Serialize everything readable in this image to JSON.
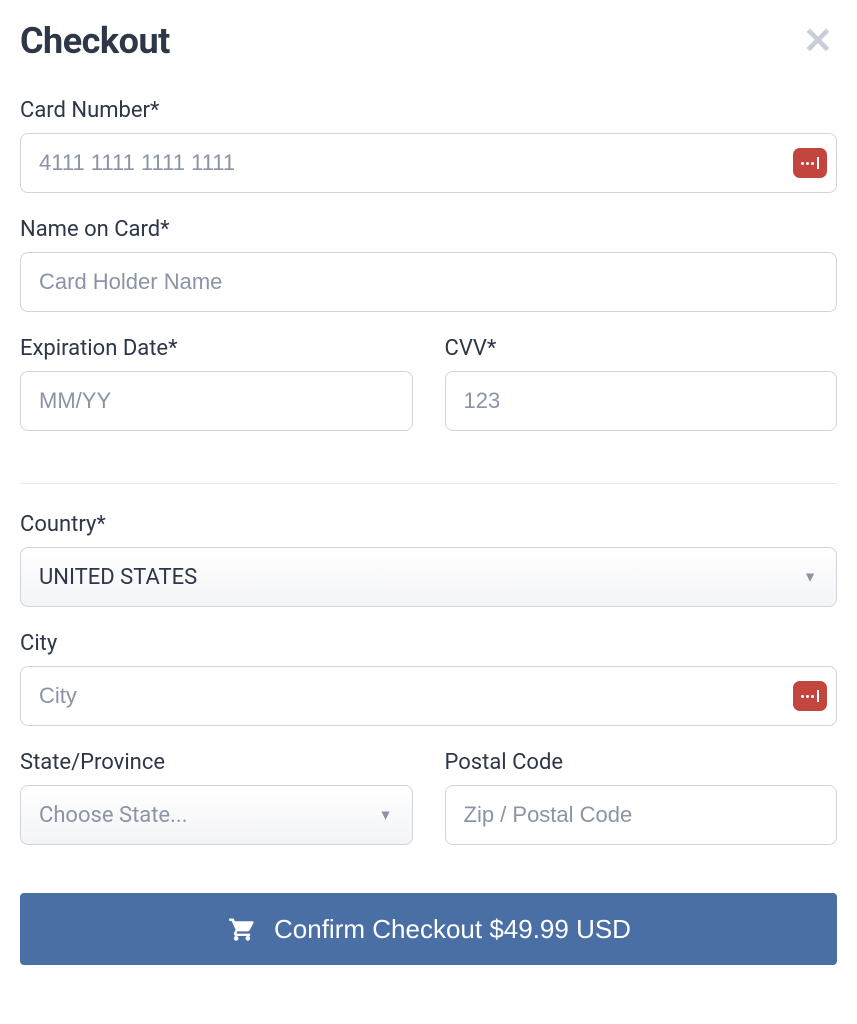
{
  "header": {
    "title": "Checkout"
  },
  "card_number": {
    "label": "Card Number*",
    "placeholder": "4111 1111 1111 1111"
  },
  "name_on_card": {
    "label": "Name on Card*",
    "placeholder": "Card Holder Name"
  },
  "expiration": {
    "label": "Expiration Date*",
    "placeholder": "MM/YY"
  },
  "cvv": {
    "label": "CVV*",
    "placeholder": "123"
  },
  "country": {
    "label": "Country*",
    "value": "UNITED STATES"
  },
  "city": {
    "label": "City",
    "placeholder": "City"
  },
  "state": {
    "label": "State/Province",
    "placeholder": "Choose State..."
  },
  "postal": {
    "label": "Postal Code",
    "placeholder": "Zip / Postal Code"
  },
  "submit": {
    "label": "Confirm Checkout $49.99 USD"
  }
}
